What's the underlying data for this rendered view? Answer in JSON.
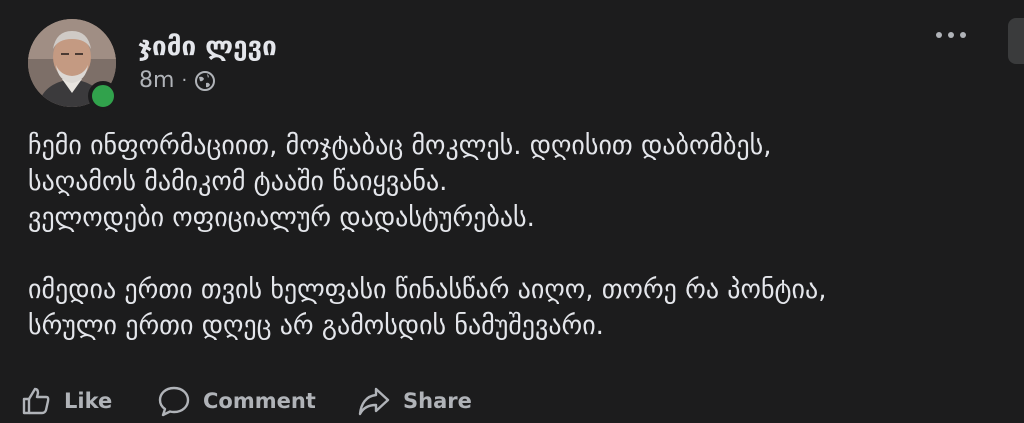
{
  "post": {
    "author": "ჯიმი ლევი",
    "timestamp": "8m",
    "separator": "·",
    "privacy_icon": "globe-icon",
    "more_icon": "more-options-icon",
    "paragraphs": [
      [
        "ჩემი ინფორმაციით, მოჯტაბაც მოკლეს. დღისით დაბომბეს,",
        "საღამოს მამიკომ ტააში წაიყვანა.",
        "ველოდები ოფიციალურ დადასტურებას."
      ],
      [
        "იმედია ერთი თვის ხელფასი წინასწარ აიღო, თორე რა პონტია,",
        "სრული ერთი დღეც არ გამოსდის ნამუშევარი."
      ]
    ]
  },
  "actions": {
    "like": "Like",
    "comment": "Comment",
    "share": "Share"
  },
  "colors": {
    "background": "#1c1c1d",
    "text_primary": "#e4e6eb",
    "text_secondary": "#b0b3b8",
    "online_indicator": "#31a24c"
  }
}
